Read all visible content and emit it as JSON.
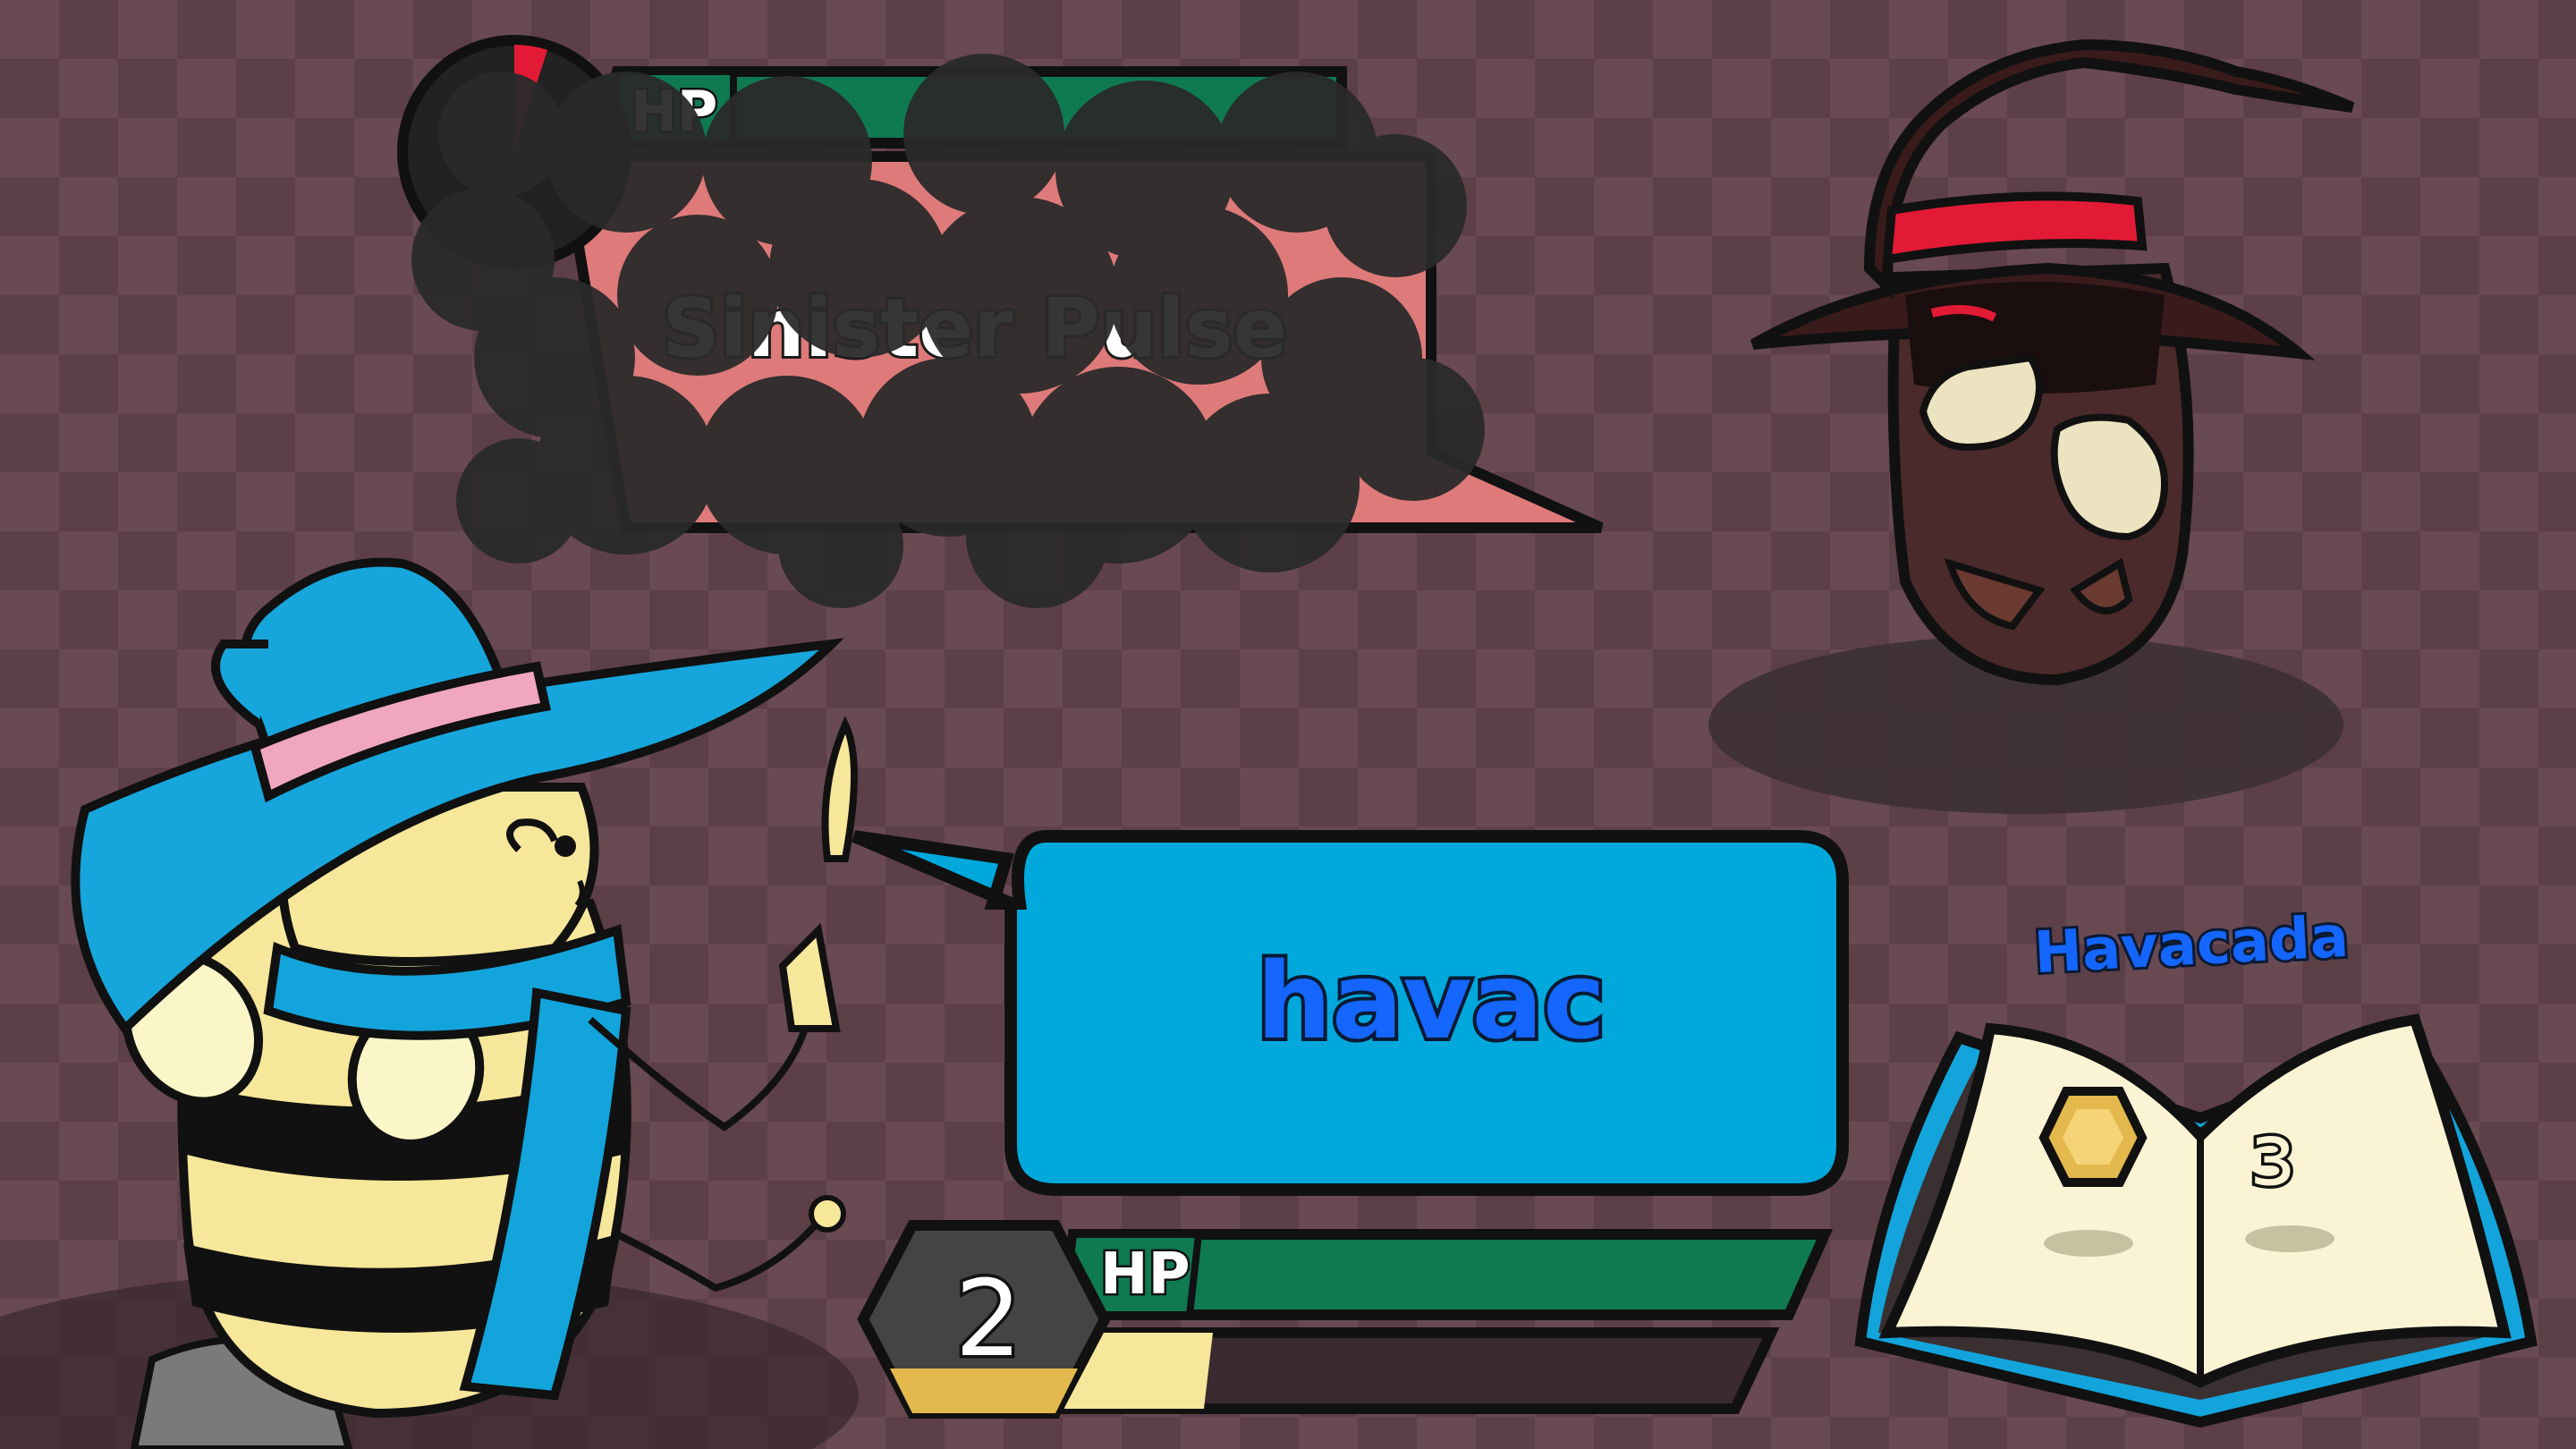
{
  "enemy": {
    "hp_label": "HP",
    "hp_fraction": 1.0,
    "turn_timer_fraction": 0.05,
    "move_name": "Sinister Pulse"
  },
  "player": {
    "hp_label": "HP",
    "hp_fraction": 1.0,
    "level": "2",
    "honey_fraction": 0.2
  },
  "speech": {
    "typed_text": "havac"
  },
  "spellbook": {
    "spell_name": "Havacada",
    "page_glyph": "ɜ"
  },
  "colors": {
    "hp_green": "#0f7a52",
    "speech_blue": "#00a8dc",
    "enemy_bubble": "#df7a7a",
    "text_blue": "#1466ff",
    "honey": "#e3b84c"
  },
  "icons": {
    "enemy_timer": "turn-timer-icon",
    "honeycomb": "honeycomb-icon"
  }
}
